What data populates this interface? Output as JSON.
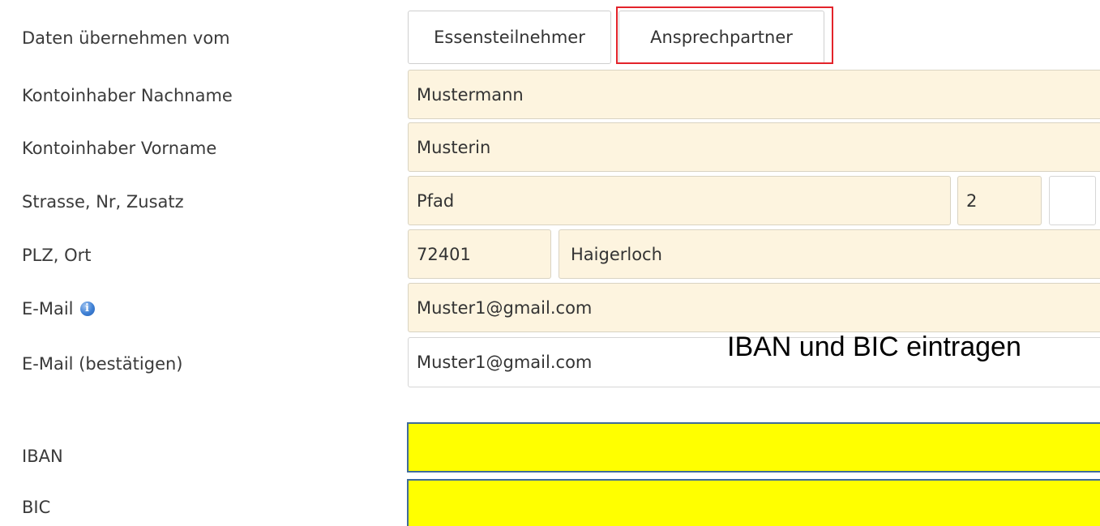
{
  "form": {
    "labels": {
      "copy_from": "Daten übernehmen vom",
      "last_name": "Kontoinhaber Nachname",
      "first_name": "Kontoinhaber Vorname",
      "street": "Strasse, Nr, Zusatz",
      "zip_city": "PLZ, Ort",
      "email": "E-Mail",
      "email_confirm": "E-Mail (bestätigen)",
      "iban": "IBAN",
      "bic": "BIC"
    },
    "buttons": {
      "participant": "Essensteilnehmer",
      "contact": "Ansprechpartner"
    },
    "values": {
      "last_name": "Mustermann",
      "first_name": "Musterin",
      "street": "Pfad",
      "house_number": "2",
      "addition": "",
      "zip": "72401",
      "city": "Haigerloch",
      "email": "Muster1@gmail.com",
      "email_confirm": "Muster1@gmail.com",
      "iban": "",
      "bic": ""
    },
    "info_icon_glyph": "i"
  },
  "annotation": {
    "text": "IBAN und BIC eintragen",
    "highlight_color": "#e3232a"
  },
  "colors": {
    "prefilled_field": "#fdf4df",
    "required_empty_field": "#ffff00",
    "required_field_border": "#3f6c9a"
  },
  "icons": [
    "info-icon"
  ]
}
